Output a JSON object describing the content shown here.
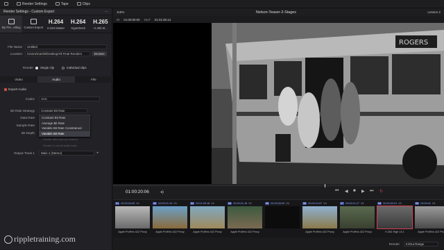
{
  "toolbar": {
    "items": [
      {
        "label": "Render Settings"
      },
      {
        "label": "Tape"
      },
      {
        "label": "Clips"
      }
    ],
    "zoom": "118%"
  },
  "render_panel": {
    "title": "Render Settings - Custom Export",
    "presets": [
      {
        "label": "My Pre...etting",
        "big": ""
      },
      {
        "label": "Custom Export",
        "big": ""
      },
      {
        "label": "H.264 Master",
        "big": "H.264"
      },
      {
        "label": "HyperDeck",
        "big": "H.264"
      },
      {
        "label": "H.265 M...",
        "big": "H.265"
      }
    ],
    "file_name_label": "File Name",
    "file_name_value": "Untitled",
    "location_label": "Location",
    "location_value": "/Users/marshi/Desktop/All Final Renders",
    "browse_label": "Browse",
    "render_label": "Render",
    "single_clip_label": "Single clip",
    "individual_clips_label": "Individual clips",
    "tabs": [
      "Video",
      "Audio",
      "File"
    ],
    "export_audio_label": "Export Audio",
    "codec_label": "Codec",
    "codec_value": "AAC",
    "bitrate_strategy_label": "Bit Rate Strategy",
    "bitrate_strategy_value": "Constant Bit Rate",
    "data_rate_label": "Data Rate",
    "sample_rate_label": "Sample Rate",
    "bit_depth_label": "Bit Depth",
    "hint_line1": "Render with track per channel",
    "hint_line2": "Render in one-bit audio track",
    "output_track_label": "Output Track 1",
    "output_track_value": "Main 1 (Stereo)",
    "dropdown_options": [
      "Constant Bit Rate",
      "Average Bit Rate",
      "Variable Bit Rate Constrained",
      "Variable Bit Rate"
    ]
  },
  "viewer": {
    "project_title": "Nelson-Teaser-2-Stages",
    "timeline_name": "Lesson 2",
    "in_label": "IN",
    "in_tc": "01:00:00:00",
    "out_label": "OUT",
    "out_tc": "01:01:06:13",
    "playhead_tc": "01:00:20:06",
    "bus_sign": "ROGERS"
  },
  "clips": [
    {
      "n": "01",
      "tc": "00:00:04:05",
      "track": "V1",
      "name": "Apple ProRes 422 Proxy"
    },
    {
      "n": "02",
      "tc": "00:00:21:13",
      "track": "V1",
      "name": "Apple ProRes 422 Proxy"
    },
    {
      "n": "03",
      "tc": "00:01:09:18",
      "track": "V1",
      "name": "Apple ProRes 422 Proxy"
    },
    {
      "n": "04",
      "tc": "00:00:21:18",
      "track": "V1",
      "name": "Apple ProRes 422 Proxy"
    },
    {
      "n": "05",
      "tc": "00:00:00:00",
      "track": "V1",
      "name": ""
    },
    {
      "n": "06",
      "tc": "00:00:10:07",
      "track": "V1",
      "name": "Apple ProRes 422 Proxy"
    },
    {
      "n": "07",
      "tc": "00:00:11:17",
      "track": "V1",
      "name": "Apple ProRes 422 Proxy"
    },
    {
      "n": "08",
      "tc": "00:00:02:01",
      "track": "V1",
      "name": "H.264 High L5.1"
    },
    {
      "n": "09",
      "tc": "00:00:01",
      "track": "V1",
      "name": "Apple ProRes 422 Proxy"
    }
  ],
  "bottom": {
    "render_label": "Render",
    "range_value": "In/Out Range"
  },
  "watermark": "rippletraining.com",
  "colors": {
    "accent_red": "#d04050",
    "clip_blue": "#3b4fa8"
  }
}
